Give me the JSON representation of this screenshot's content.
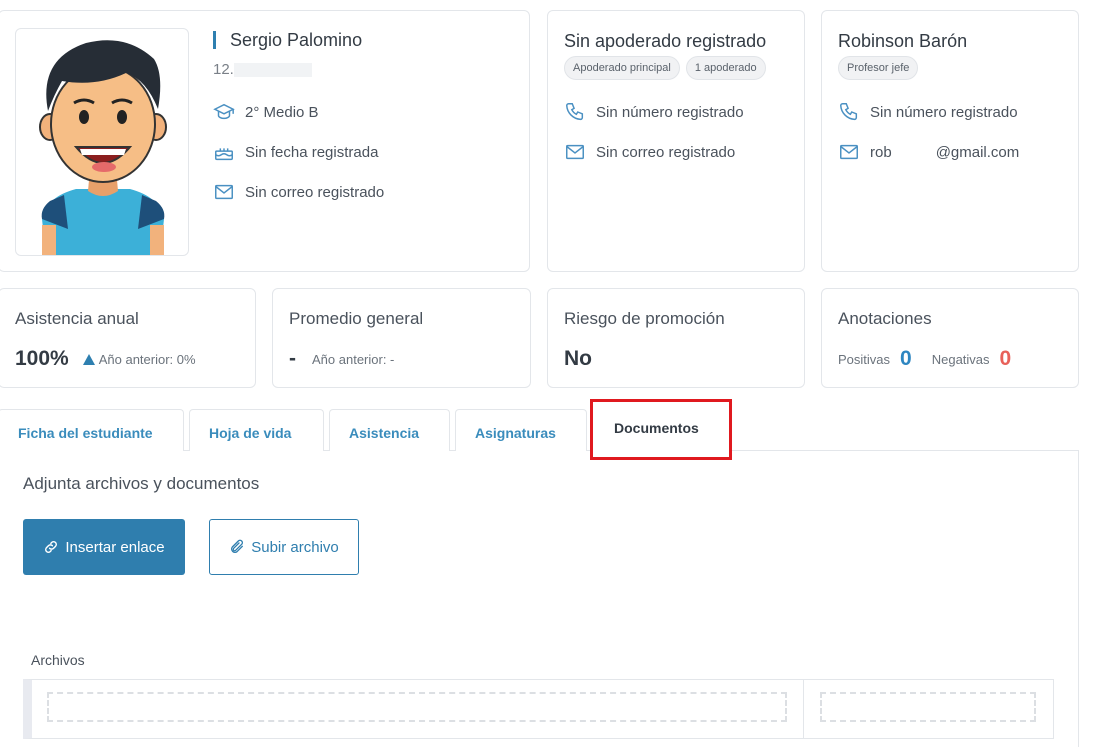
{
  "student": {
    "name": "Sergio Palomino",
    "rut_prefix": "12.",
    "course": "2° Medio B",
    "birthdate": "Sin fecha registrada",
    "email": "Sin correo registrado"
  },
  "guardian": {
    "title": "Sin apoderado registrado",
    "chips": [
      "Apoderado principal",
      "1 apoderado"
    ],
    "phone": "Sin número registrado",
    "email": "Sin correo registrado"
  },
  "teacher": {
    "name": "Robinson Barón",
    "chip": "Profesor jefe",
    "phone": "Sin número registrado",
    "email_prefix": "rob",
    "email_suffix": "@gmail.com"
  },
  "stats": {
    "attendance": {
      "title": "Asistencia anual",
      "value": "100%",
      "prev": "Año anterior: 0%"
    },
    "average": {
      "title": "Promedio general",
      "value": "-",
      "prev": "Año anterior: -"
    },
    "risk": {
      "title": "Riesgo de promoción",
      "value": "No"
    },
    "notes": {
      "title": "Anotaciones",
      "positive_label": "Positivas",
      "positive_value": "0",
      "negative_label": "Negativas",
      "negative_value": "0"
    }
  },
  "tabs": [
    "Ficha del estudiante",
    "Hoja de vida",
    "Asistencia",
    "Asignaturas",
    "Documentos"
  ],
  "documents": {
    "heading": "Adjunta archivos y documentos",
    "insert_link": "Insertar enlace",
    "upload_file": "Subir archivo",
    "files_label": "Archivos"
  },
  "colors": {
    "primary": "#2f7eae",
    "positive": "#2e86c1",
    "negative": "#e8615a",
    "highlight": "#e0191f"
  }
}
